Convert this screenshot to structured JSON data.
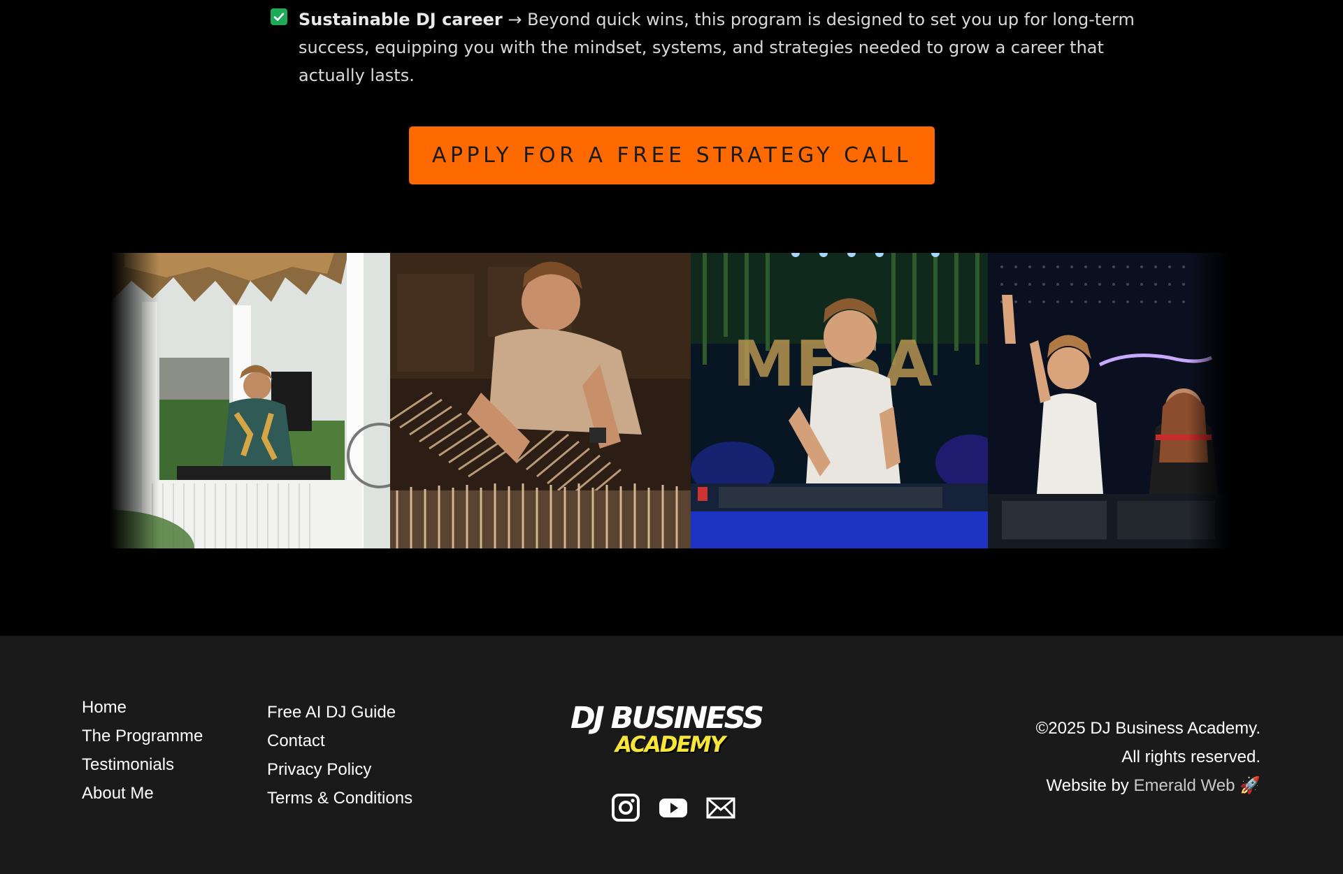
{
  "benefit": {
    "title": "Sustainable DJ career",
    "arrow": "→",
    "text": "Beyond quick wins, this program is designed to set you up for long-term success, equipping you with the mindset, systems, and strategies needed to grow a career that actually lasts."
  },
  "cta": {
    "label": "APPLY FOR A FREE STRATEGY CALL",
    "color": "#ff6a00"
  },
  "gallery": {
    "photos": [
      "DJ at outdoor beach bar deck",
      "DJ browsing vinyl records",
      "DJ performing at MESA club",
      "DJ performing at night club"
    ]
  },
  "footer": {
    "nav_col1": [
      "Home",
      "The Programme",
      "Testimonials",
      "About Me"
    ],
    "nav_col2": [
      "Free AI DJ Guide",
      "Contact",
      "Privacy Policy",
      "Terms & Conditions"
    ],
    "logo": {
      "line1": "DJ BUSINESS",
      "line2": "ACADEMY",
      "accent": "#f7e53a"
    },
    "social": [
      "instagram-icon",
      "youtube-icon",
      "email-icon"
    ],
    "copyright": "©2025 DJ Business Academy.",
    "rights": "All rights reserved.",
    "credit_prefix": "Website by",
    "credit_link": "Emerald Web",
    "credit_emoji": "🚀"
  }
}
